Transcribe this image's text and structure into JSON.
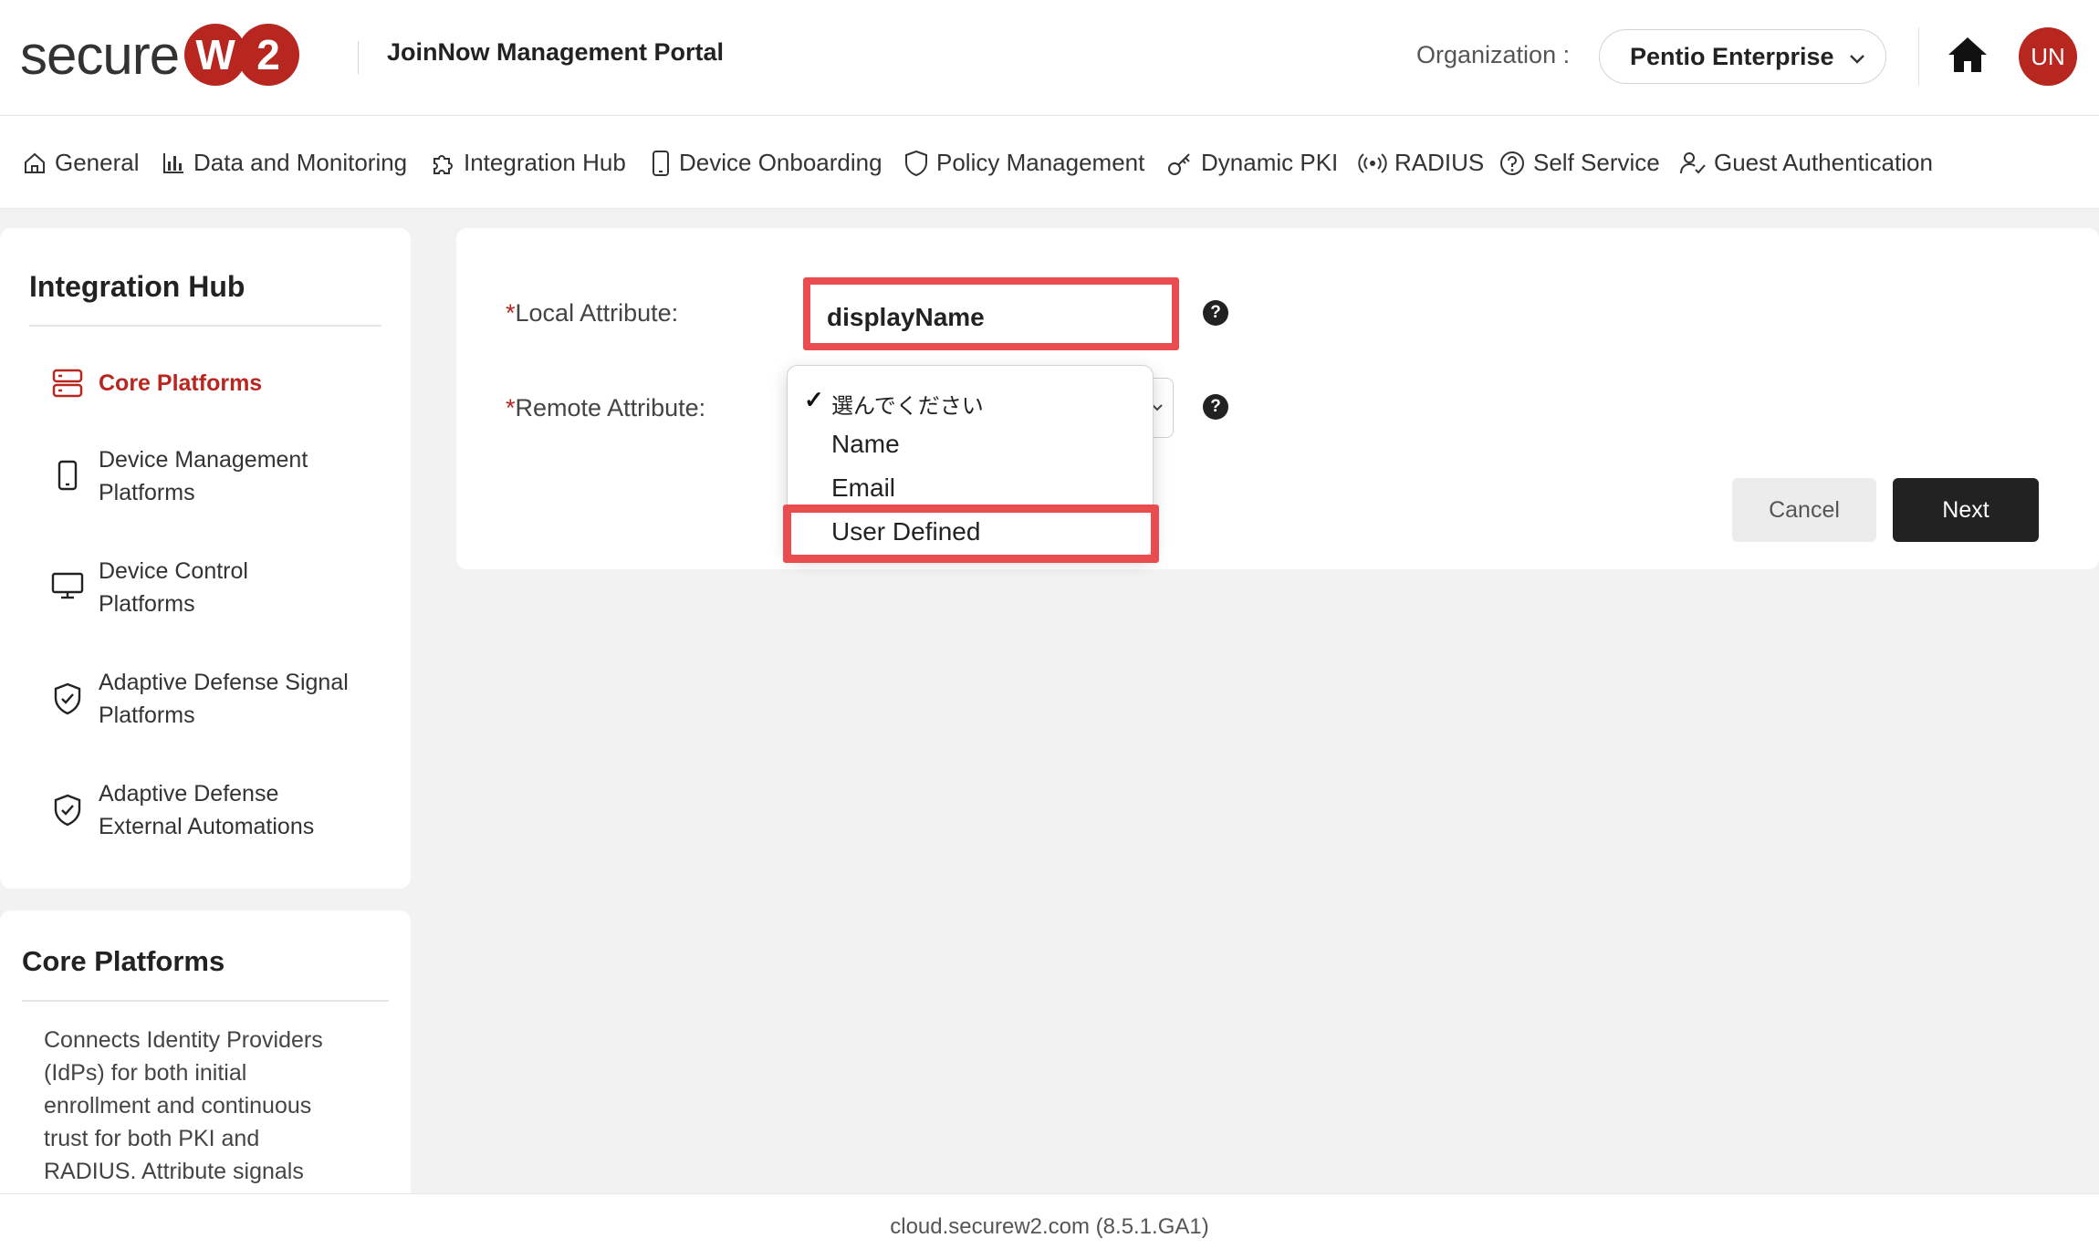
{
  "header": {
    "logo_text": "secure",
    "logo_badge_1": "W",
    "logo_badge_2": "2",
    "portal_title": "JoinNow Management Portal",
    "org_label": "Organization :",
    "org_value": "Pentio Enterprise",
    "avatar_initials": "UN"
  },
  "nav": {
    "items": [
      {
        "label": "General",
        "icon": "home-outline-icon"
      },
      {
        "label": "Data and Monitoring",
        "icon": "bar-chart-icon"
      },
      {
        "label": "Integration Hub",
        "icon": "puzzle-icon"
      },
      {
        "label": "Device Onboarding",
        "icon": "phone-icon"
      },
      {
        "label": "Policy Management",
        "icon": "shield-icon"
      },
      {
        "label": "Dynamic PKI",
        "icon": "key-icon"
      },
      {
        "label": "RADIUS",
        "icon": "broadcast-icon"
      },
      {
        "label": "Self Service",
        "icon": "question-circle-icon"
      },
      {
        "label": "Guest Authentication",
        "icon": "user-check-icon"
      }
    ]
  },
  "sidebar": {
    "title": "Integration Hub",
    "items": [
      {
        "label": "Core Platforms",
        "icon": "server-icon",
        "active": true
      },
      {
        "label": "Device Management Platforms",
        "icon": "phone-icon"
      },
      {
        "label": "Device Control Platforms",
        "icon": "monitor-icon"
      },
      {
        "label": "Adaptive Defense Signal Platforms",
        "icon": "shield-check-icon"
      },
      {
        "label": "Adaptive Defense External Automations",
        "icon": "shield-check-icon"
      }
    ]
  },
  "info": {
    "title": "Core Platforms",
    "text": "Connects Identity Providers (IdPs) for both initial enrollment and continuous trust for both PKI and RADIUS. Attribute signals"
  },
  "form": {
    "required_mark": "*",
    "local_label": "Local Attribute:",
    "local_value": "displayName",
    "remote_label": "Remote Attribute:",
    "remote_options": [
      "選んでください",
      "Name",
      "Email",
      "User Defined"
    ],
    "remote_selected": "選んでください",
    "check_mark": "✓",
    "help": "?"
  },
  "buttons": {
    "cancel": "Cancel",
    "next": "Next"
  },
  "footer": {
    "text": "cloud.securew2.com (8.5.1.GA1)"
  },
  "colors": {
    "brand_red": "#b7261f",
    "highlight_red": "#e84c4f"
  }
}
